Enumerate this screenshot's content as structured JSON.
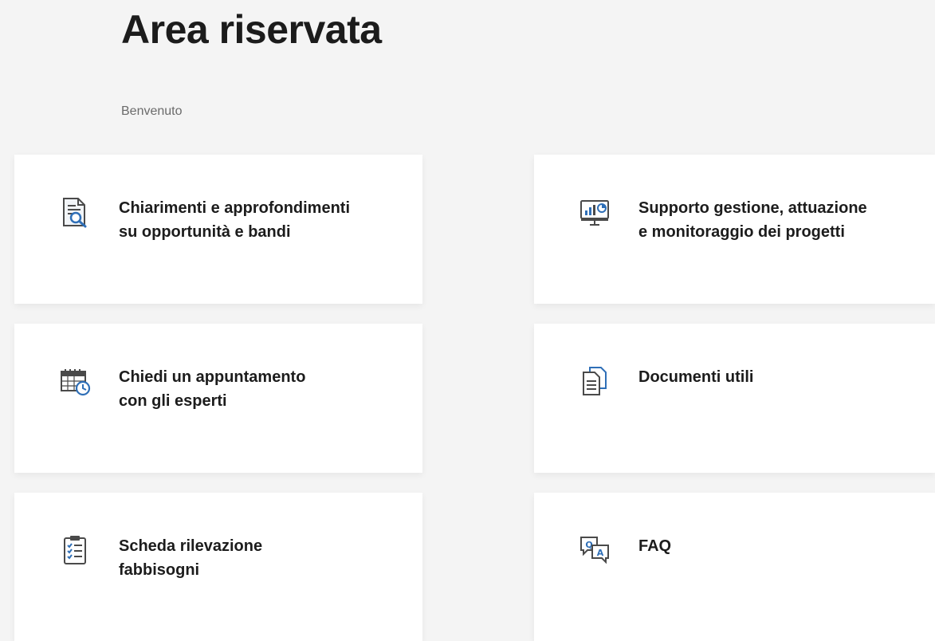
{
  "header": {
    "title": "Area riservata",
    "welcome": "Benvenuto"
  },
  "cards": [
    {
      "label": "Chiarimenti e approfondimenti\nsu opportunità e bandi",
      "icon": "document-search-icon"
    },
    {
      "label": "Supporto gestione, attuazione\ne monitoraggio dei progetti",
      "icon": "monitor-chart-icon"
    },
    {
      "label": "Chiedi un appuntamento\ncon gli esperti",
      "icon": "calendar-clock-icon"
    },
    {
      "label": "Documenti utili",
      "icon": "documents-icon"
    },
    {
      "label": "Scheda rilevazione\nfabbisogni",
      "icon": "checklist-icon"
    },
    {
      "label": "FAQ",
      "icon": "faq-chat-icon"
    }
  ],
  "colors": {
    "accent": "#2f6fb7",
    "background": "#f4f4f4",
    "card": "#ffffff"
  }
}
